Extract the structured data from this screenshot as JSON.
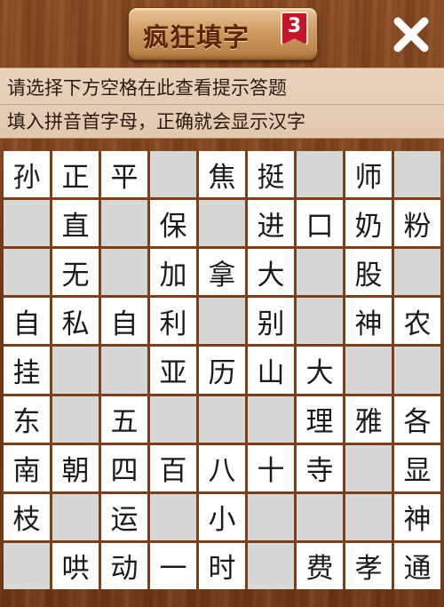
{
  "header": {
    "title": "疯狂填字",
    "level": "3",
    "close_icon": "close-icon"
  },
  "hints": {
    "line1": "请选择下方空格在此查看提示答题",
    "line2": "填入拼音首字母，正确就会显示汉字"
  },
  "colors": {
    "wood": "#7a3f1b",
    "panel": "#e6cfb7",
    "badge": "#c4162a",
    "empty_cell": "#d7d7d7",
    "filled_cell": "#ffffff"
  },
  "board": {
    "rows": [
      [
        "孙",
        "正",
        "平",
        "",
        "焦",
        "挺",
        "",
        "师",
        ""
      ],
      [
        "",
        "直",
        "",
        "保",
        "",
        "进",
        "口",
        "奶",
        "粉"
      ],
      [
        "",
        "无",
        "",
        "加",
        "拿",
        "大",
        "",
        "股",
        ""
      ],
      [
        "自",
        "私",
        "自",
        "利",
        "",
        "别",
        "",
        "神",
        "农"
      ],
      [
        "挂",
        "",
        "",
        "亚",
        "历",
        "山",
        "大",
        "",
        ""
      ],
      [
        "东",
        "",
        "五",
        "",
        "",
        "",
        "理",
        "雅",
        "各"
      ],
      [
        "南",
        "朝",
        "四",
        "百",
        "八",
        "十",
        "寺",
        "",
        "显"
      ],
      [
        "枝",
        "",
        "运",
        "",
        "小",
        "",
        "",
        "",
        "神"
      ],
      [
        "",
        "哄",
        "动",
        "一",
        "时",
        "",
        "费",
        "孝",
        "通"
      ]
    ]
  }
}
